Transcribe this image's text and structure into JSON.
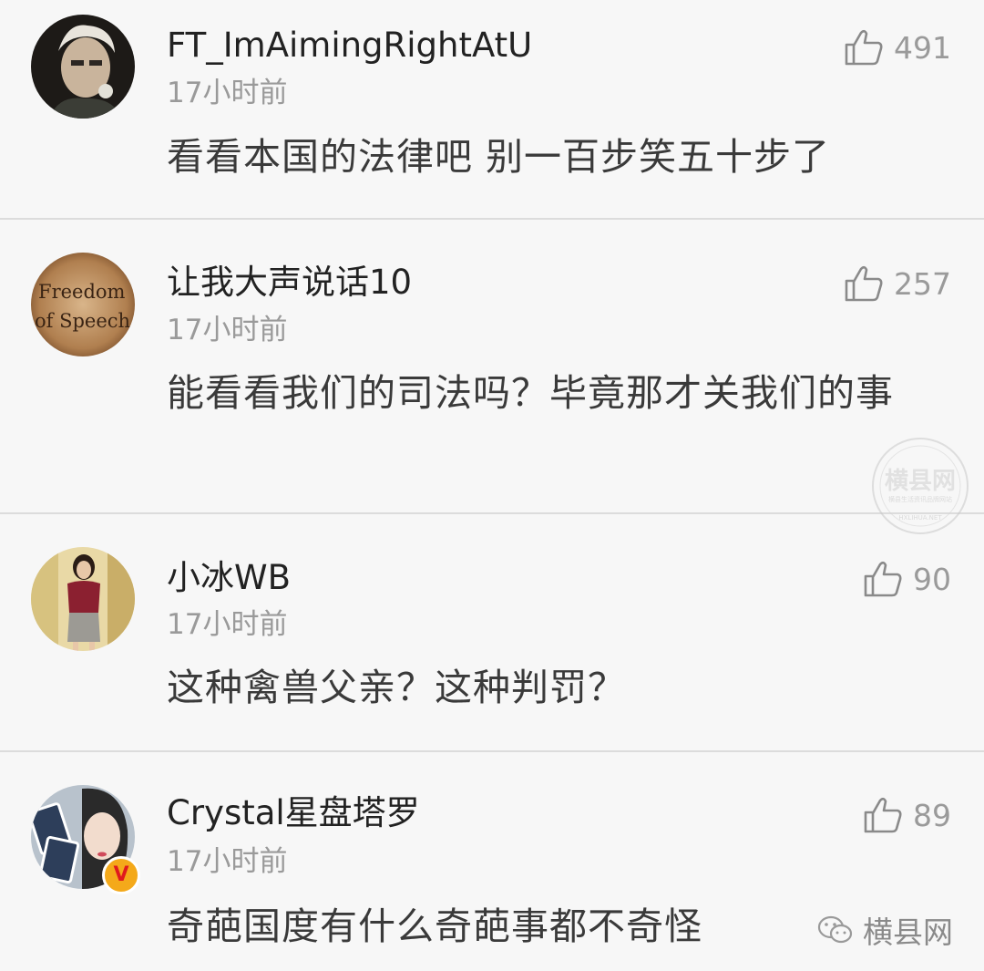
{
  "comments": [
    {
      "username": "FT_ImAimingRightAtU",
      "time": "17小时前",
      "likes": "491",
      "text": "看看本国的法律吧 别一百步笑五十步了"
    },
    {
      "username": "让我大声说话10",
      "time": "17小时前",
      "likes": "257",
      "text": "能看看我们的司法吗？毕竟那才关我们的事",
      "avatar_text": {
        "line1": "Freedom",
        "line2": "of Speech"
      }
    },
    {
      "username": "小冰WB",
      "time": "17小时前",
      "likes": "90",
      "text": "这种禽兽父亲？这种判罚？"
    },
    {
      "username": "Crystal星盘塔罗",
      "time": "17小时前",
      "likes": "89",
      "text": "奇葩国度有什么奇葩事都不奇怪",
      "badge": "V"
    }
  ],
  "watermark": {
    "name": "横县网",
    "sub": "横县生活资讯品牌网站",
    "url": "HXLIHUA.NET"
  },
  "footer": {
    "brand": "横县网"
  },
  "icons": {
    "like": "thumbs-up-icon",
    "wechat": "wechat-icon",
    "verified": "verified-badge-icon"
  },
  "colors": {
    "background": "#f7f7f7",
    "muted": "#9a9a9a",
    "badge": "#f4a91a"
  }
}
